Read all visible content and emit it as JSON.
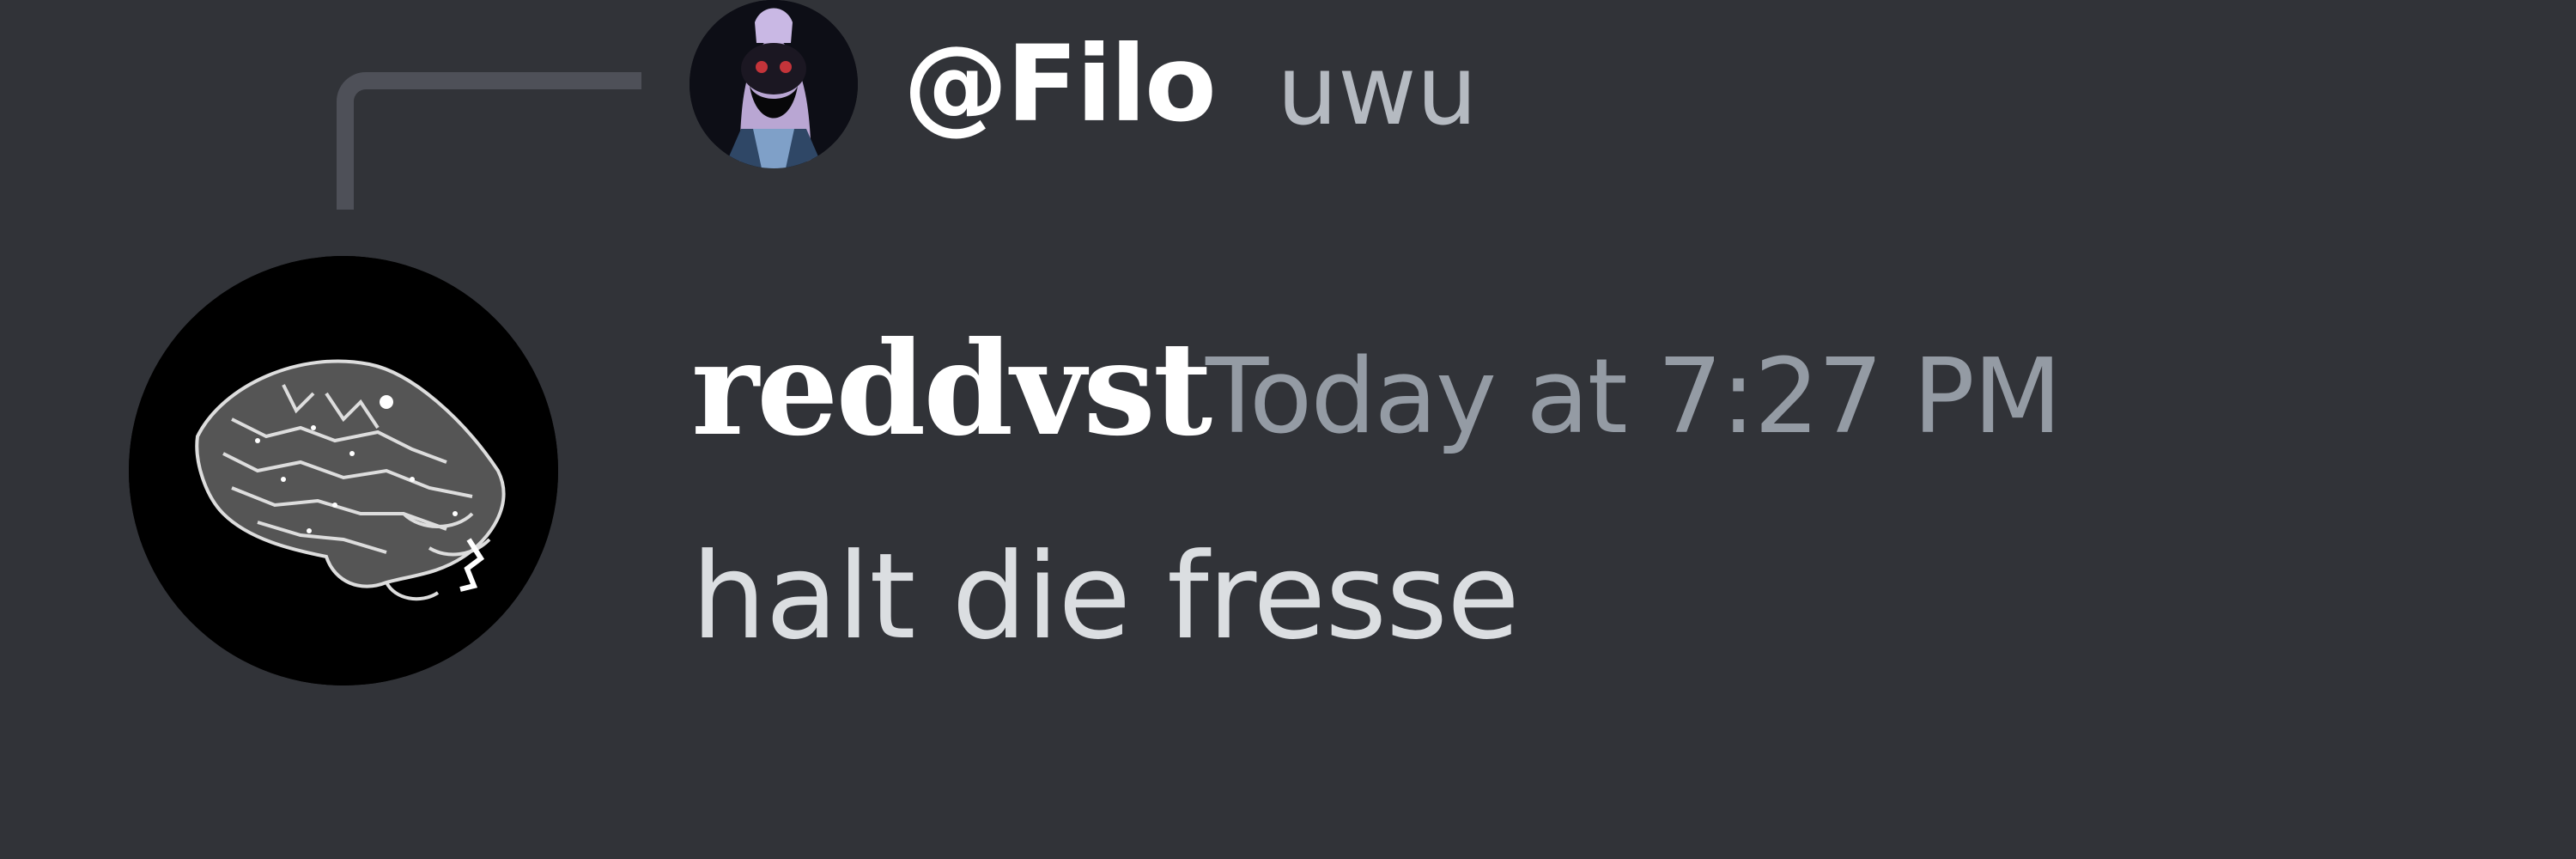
{
  "reply": {
    "username": "@Filo",
    "text": "uwu",
    "avatar_icon": "hooded-figure-avatar-icon"
  },
  "message": {
    "author": "reddvst",
    "timestamp": "Today at 7:27 PM",
    "content": "halt die fresse",
    "avatar_icon": "engraved-beast-avatar-icon"
  },
  "colors": {
    "background": "#313338",
    "username": "#ffffff",
    "timestamp": "#949ba4",
    "content": "#dbdee1",
    "reply_text": "#b5bac1",
    "reply_spine": "#4e5058"
  }
}
